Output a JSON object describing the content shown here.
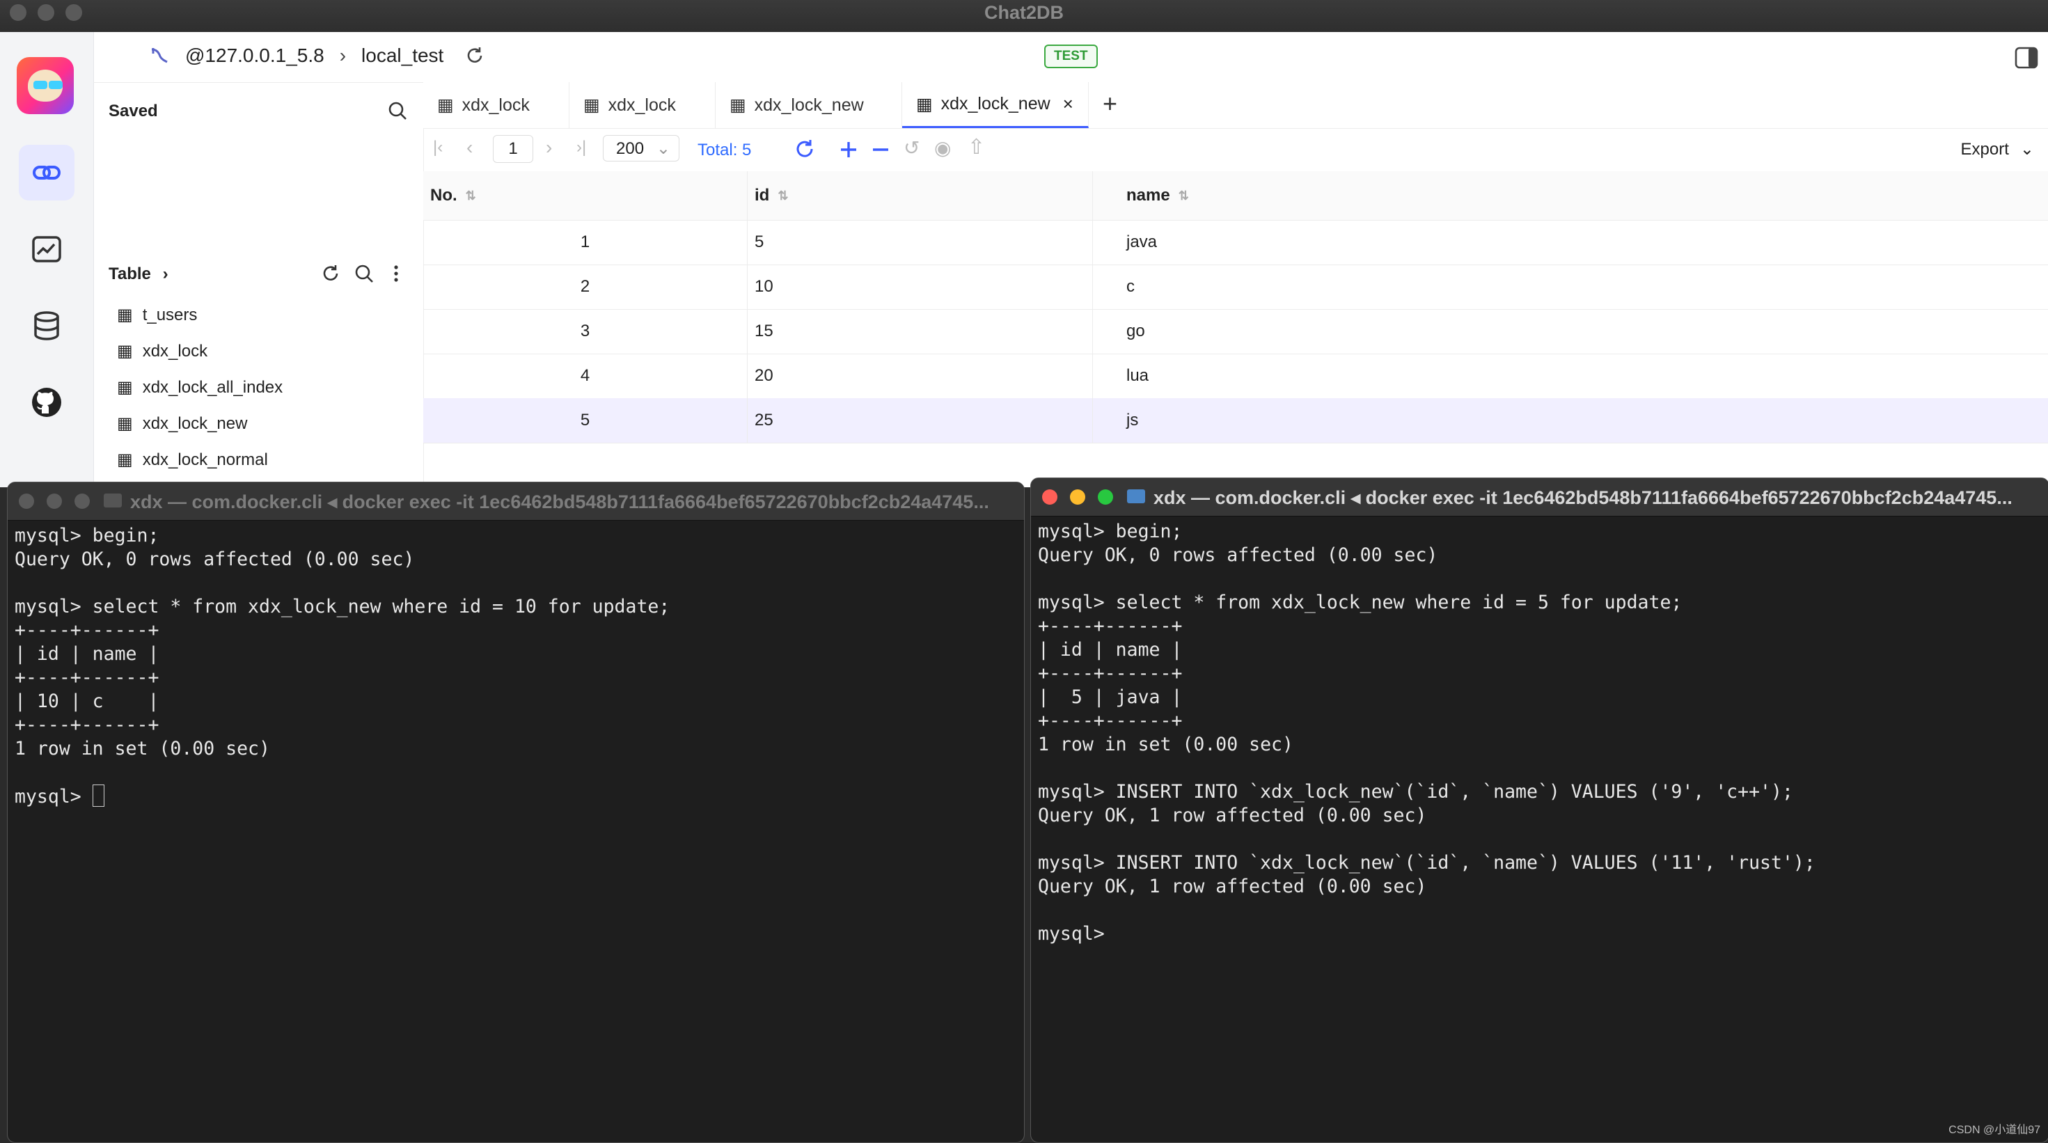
{
  "window": {
    "title": "Chat2DB"
  },
  "header": {
    "connection": "@127.0.0.1_5.8",
    "database": "local_test",
    "env_badge": "TEST"
  },
  "sidebar": {
    "saved_label": "Saved",
    "table_label": "Table",
    "tables": [
      "t_users",
      "xdx_lock",
      "xdx_lock_all_index",
      "xdx_lock_new",
      "xdx_lock_normal"
    ]
  },
  "tabs": [
    "xdx_lock",
    "xdx_lock",
    "xdx_lock_new",
    "xdx_lock_new"
  ],
  "toolbar": {
    "page": "1",
    "page_size": "200",
    "total_label": "Total:",
    "total_value": "5",
    "export_label": "Export"
  },
  "grid": {
    "columns": [
      "No.",
      "id",
      "name"
    ],
    "rows": [
      [
        "1",
        "5",
        "java"
      ],
      [
        "2",
        "10",
        "c"
      ],
      [
        "3",
        "15",
        "go"
      ],
      [
        "4",
        "20",
        "lua"
      ],
      [
        "5",
        "25",
        "js"
      ]
    ]
  },
  "terminal_left": {
    "title": "xdx — com.docker.cli ◂ docker exec -it 1ec6462bd548b7111fa6664bef65722670bbcf2cb24a4745...",
    "lines": [
      "mysql> begin;",
      "Query OK, 0 rows affected (0.00 sec)",
      "",
      "mysql> select * from xdx_lock_new where id = 10 for update;",
      "+----+------+",
      "| id | name |",
      "+----+------+",
      "| 10 | c    |",
      "+----+------+",
      "1 row in set (0.00 sec)",
      "",
      "mysql> "
    ]
  },
  "terminal_right": {
    "title": "xdx — com.docker.cli ◂ docker exec -it 1ec6462bd548b7111fa6664bef65722670bbcf2cb24a4745...",
    "lines": [
      "mysql> begin;",
      "Query OK, 0 rows affected (0.00 sec)",
      "",
      "mysql> select * from xdx_lock_new where id = 5 for update;",
      "+----+------+",
      "| id | name |",
      "+----+------+",
      "|  5 | java |",
      "+----+------+",
      "1 row in set (0.00 sec)",
      "",
      "mysql> INSERT INTO `xdx_lock_new`(`id`, `name`) VALUES ('9', 'c++');",
      "Query OK, 1 row affected (0.00 sec)",
      "",
      "mysql> INSERT INTO `xdx_lock_new`(`id`, `name`) VALUES ('11', 'rust');",
      "Query OK, 1 row affected (0.00 sec)",
      "",
      "mysql> "
    ]
  },
  "watermark": "CSDN @小道仙97"
}
